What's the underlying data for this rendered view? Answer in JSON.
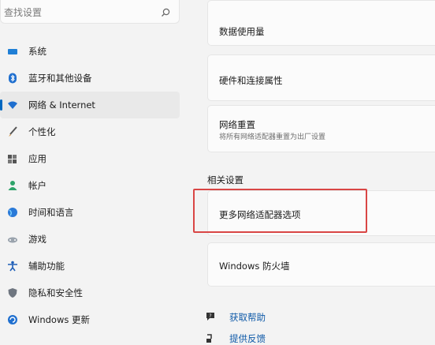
{
  "search": {
    "placeholder": "查找设置"
  },
  "sidebar": {
    "items": [
      {
        "label": "系统"
      },
      {
        "label": "蓝牙和其他设备"
      },
      {
        "label": "网络 & Internet"
      },
      {
        "label": "个性化"
      },
      {
        "label": "应用"
      },
      {
        "label": "帐户"
      },
      {
        "label": "时间和语言"
      },
      {
        "label": "游戏"
      },
      {
        "label": "辅助功能"
      },
      {
        "label": "隐私和安全性"
      },
      {
        "label": "Windows 更新"
      }
    ]
  },
  "content": {
    "cards": [
      {
        "title": "数据使用量"
      },
      {
        "title": "硬件和连接属性"
      },
      {
        "title": "网络重置",
        "subtitle": "将所有网络适配器重置为出厂设置"
      }
    ],
    "related_heading": "相关设置",
    "related_cards": [
      {
        "title": "更多网络适配器选项"
      },
      {
        "title": "Windows 防火墙"
      }
    ],
    "links": [
      {
        "label": "获取帮助"
      },
      {
        "label": "提供反馈"
      }
    ]
  },
  "colors": {
    "accent": "#0067c0",
    "highlight": "#d94645",
    "link": "#0f5aa8"
  }
}
